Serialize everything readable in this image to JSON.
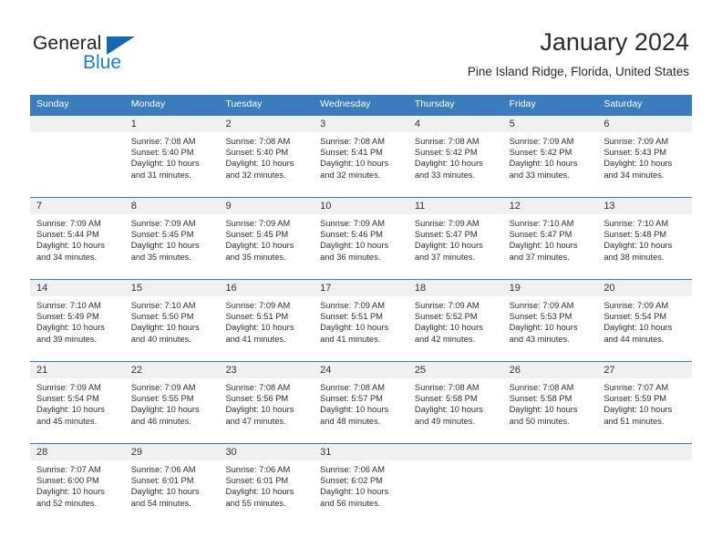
{
  "brand": {
    "name_top": "General",
    "name_bottom": "Blue",
    "accent_color": "#1268b3",
    "blue_text_color": "#1a7fd4"
  },
  "header": {
    "title": "January 2024",
    "subtitle": "Pine Island Ridge, Florida, United States"
  },
  "colors": {
    "header_row_bg": "#3a7cbe",
    "day_strip_bg": "#f0f0f0",
    "cell_bg": "#ffffff",
    "text": "#2d2d2d"
  },
  "weekdays": [
    "Sunday",
    "Monday",
    "Tuesday",
    "Wednesday",
    "Thursday",
    "Friday",
    "Saturday"
  ],
  "weeks": [
    [
      {
        "day": "",
        "sunrise": "",
        "sunset": "",
        "daylight_line1": "",
        "daylight_line2": ""
      },
      {
        "day": "1",
        "sunrise": "Sunrise: 7:08 AM",
        "sunset": "Sunset: 5:40 PM",
        "daylight_line1": "Daylight: 10 hours",
        "daylight_line2": "and 31 minutes."
      },
      {
        "day": "2",
        "sunrise": "Sunrise: 7:08 AM",
        "sunset": "Sunset: 5:40 PM",
        "daylight_line1": "Daylight: 10 hours",
        "daylight_line2": "and 32 minutes."
      },
      {
        "day": "3",
        "sunrise": "Sunrise: 7:08 AM",
        "sunset": "Sunset: 5:41 PM",
        "daylight_line1": "Daylight: 10 hours",
        "daylight_line2": "and 32 minutes."
      },
      {
        "day": "4",
        "sunrise": "Sunrise: 7:08 AM",
        "sunset": "Sunset: 5:42 PM",
        "daylight_line1": "Daylight: 10 hours",
        "daylight_line2": "and 33 minutes."
      },
      {
        "day": "5",
        "sunrise": "Sunrise: 7:09 AM",
        "sunset": "Sunset: 5:42 PM",
        "daylight_line1": "Daylight: 10 hours",
        "daylight_line2": "and 33 minutes."
      },
      {
        "day": "6",
        "sunrise": "Sunrise: 7:09 AM",
        "sunset": "Sunset: 5:43 PM",
        "daylight_line1": "Daylight: 10 hours",
        "daylight_line2": "and 34 minutes."
      }
    ],
    [
      {
        "day": "7",
        "sunrise": "Sunrise: 7:09 AM",
        "sunset": "Sunset: 5:44 PM",
        "daylight_line1": "Daylight: 10 hours",
        "daylight_line2": "and 34 minutes."
      },
      {
        "day": "8",
        "sunrise": "Sunrise: 7:09 AM",
        "sunset": "Sunset: 5:45 PM",
        "daylight_line1": "Daylight: 10 hours",
        "daylight_line2": "and 35 minutes."
      },
      {
        "day": "9",
        "sunrise": "Sunrise: 7:09 AM",
        "sunset": "Sunset: 5:45 PM",
        "daylight_line1": "Daylight: 10 hours",
        "daylight_line2": "and 35 minutes."
      },
      {
        "day": "10",
        "sunrise": "Sunrise: 7:09 AM",
        "sunset": "Sunset: 5:46 PM",
        "daylight_line1": "Daylight: 10 hours",
        "daylight_line2": "and 36 minutes."
      },
      {
        "day": "11",
        "sunrise": "Sunrise: 7:09 AM",
        "sunset": "Sunset: 5:47 PM",
        "daylight_line1": "Daylight: 10 hours",
        "daylight_line2": "and 37 minutes."
      },
      {
        "day": "12",
        "sunrise": "Sunrise: 7:10 AM",
        "sunset": "Sunset: 5:47 PM",
        "daylight_line1": "Daylight: 10 hours",
        "daylight_line2": "and 37 minutes."
      },
      {
        "day": "13",
        "sunrise": "Sunrise: 7:10 AM",
        "sunset": "Sunset: 5:48 PM",
        "daylight_line1": "Daylight: 10 hours",
        "daylight_line2": "and 38 minutes."
      }
    ],
    [
      {
        "day": "14",
        "sunrise": "Sunrise: 7:10 AM",
        "sunset": "Sunset: 5:49 PM",
        "daylight_line1": "Daylight: 10 hours",
        "daylight_line2": "and 39 minutes."
      },
      {
        "day": "15",
        "sunrise": "Sunrise: 7:10 AM",
        "sunset": "Sunset: 5:50 PM",
        "daylight_line1": "Daylight: 10 hours",
        "daylight_line2": "and 40 minutes."
      },
      {
        "day": "16",
        "sunrise": "Sunrise: 7:09 AM",
        "sunset": "Sunset: 5:51 PM",
        "daylight_line1": "Daylight: 10 hours",
        "daylight_line2": "and 41 minutes."
      },
      {
        "day": "17",
        "sunrise": "Sunrise: 7:09 AM",
        "sunset": "Sunset: 5:51 PM",
        "daylight_line1": "Daylight: 10 hours",
        "daylight_line2": "and 41 minutes."
      },
      {
        "day": "18",
        "sunrise": "Sunrise: 7:09 AM",
        "sunset": "Sunset: 5:52 PM",
        "daylight_line1": "Daylight: 10 hours",
        "daylight_line2": "and 42 minutes."
      },
      {
        "day": "19",
        "sunrise": "Sunrise: 7:09 AM",
        "sunset": "Sunset: 5:53 PM",
        "daylight_line1": "Daylight: 10 hours",
        "daylight_line2": "and 43 minutes."
      },
      {
        "day": "20",
        "sunrise": "Sunrise: 7:09 AM",
        "sunset": "Sunset: 5:54 PM",
        "daylight_line1": "Daylight: 10 hours",
        "daylight_line2": "and 44 minutes."
      }
    ],
    [
      {
        "day": "21",
        "sunrise": "Sunrise: 7:09 AM",
        "sunset": "Sunset: 5:54 PM",
        "daylight_line1": "Daylight: 10 hours",
        "daylight_line2": "and 45 minutes."
      },
      {
        "day": "22",
        "sunrise": "Sunrise: 7:09 AM",
        "sunset": "Sunset: 5:55 PM",
        "daylight_line1": "Daylight: 10 hours",
        "daylight_line2": "and 46 minutes."
      },
      {
        "day": "23",
        "sunrise": "Sunrise: 7:08 AM",
        "sunset": "Sunset: 5:56 PM",
        "daylight_line1": "Daylight: 10 hours",
        "daylight_line2": "and 47 minutes."
      },
      {
        "day": "24",
        "sunrise": "Sunrise: 7:08 AM",
        "sunset": "Sunset: 5:57 PM",
        "daylight_line1": "Daylight: 10 hours",
        "daylight_line2": "and 48 minutes."
      },
      {
        "day": "25",
        "sunrise": "Sunrise: 7:08 AM",
        "sunset": "Sunset: 5:58 PM",
        "daylight_line1": "Daylight: 10 hours",
        "daylight_line2": "and 49 minutes."
      },
      {
        "day": "26",
        "sunrise": "Sunrise: 7:08 AM",
        "sunset": "Sunset: 5:58 PM",
        "daylight_line1": "Daylight: 10 hours",
        "daylight_line2": "and 50 minutes."
      },
      {
        "day": "27",
        "sunrise": "Sunrise: 7:07 AM",
        "sunset": "Sunset: 5:59 PM",
        "daylight_line1": "Daylight: 10 hours",
        "daylight_line2": "and 51 minutes."
      }
    ],
    [
      {
        "day": "28",
        "sunrise": "Sunrise: 7:07 AM",
        "sunset": "Sunset: 6:00 PM",
        "daylight_line1": "Daylight: 10 hours",
        "daylight_line2": "and 52 minutes."
      },
      {
        "day": "29",
        "sunrise": "Sunrise: 7:06 AM",
        "sunset": "Sunset: 6:01 PM",
        "daylight_line1": "Daylight: 10 hours",
        "daylight_line2": "and 54 minutes."
      },
      {
        "day": "30",
        "sunrise": "Sunrise: 7:06 AM",
        "sunset": "Sunset: 6:01 PM",
        "daylight_line1": "Daylight: 10 hours",
        "daylight_line2": "and 55 minutes."
      },
      {
        "day": "31",
        "sunrise": "Sunrise: 7:06 AM",
        "sunset": "Sunset: 6:02 PM",
        "daylight_line1": "Daylight: 10 hours",
        "daylight_line2": "and 56 minutes."
      },
      {
        "day": "",
        "sunrise": "",
        "sunset": "",
        "daylight_line1": "",
        "daylight_line2": ""
      },
      {
        "day": "",
        "sunrise": "",
        "sunset": "",
        "daylight_line1": "",
        "daylight_line2": ""
      },
      {
        "day": "",
        "sunrise": "",
        "sunset": "",
        "daylight_line1": "",
        "daylight_line2": ""
      }
    ]
  ]
}
